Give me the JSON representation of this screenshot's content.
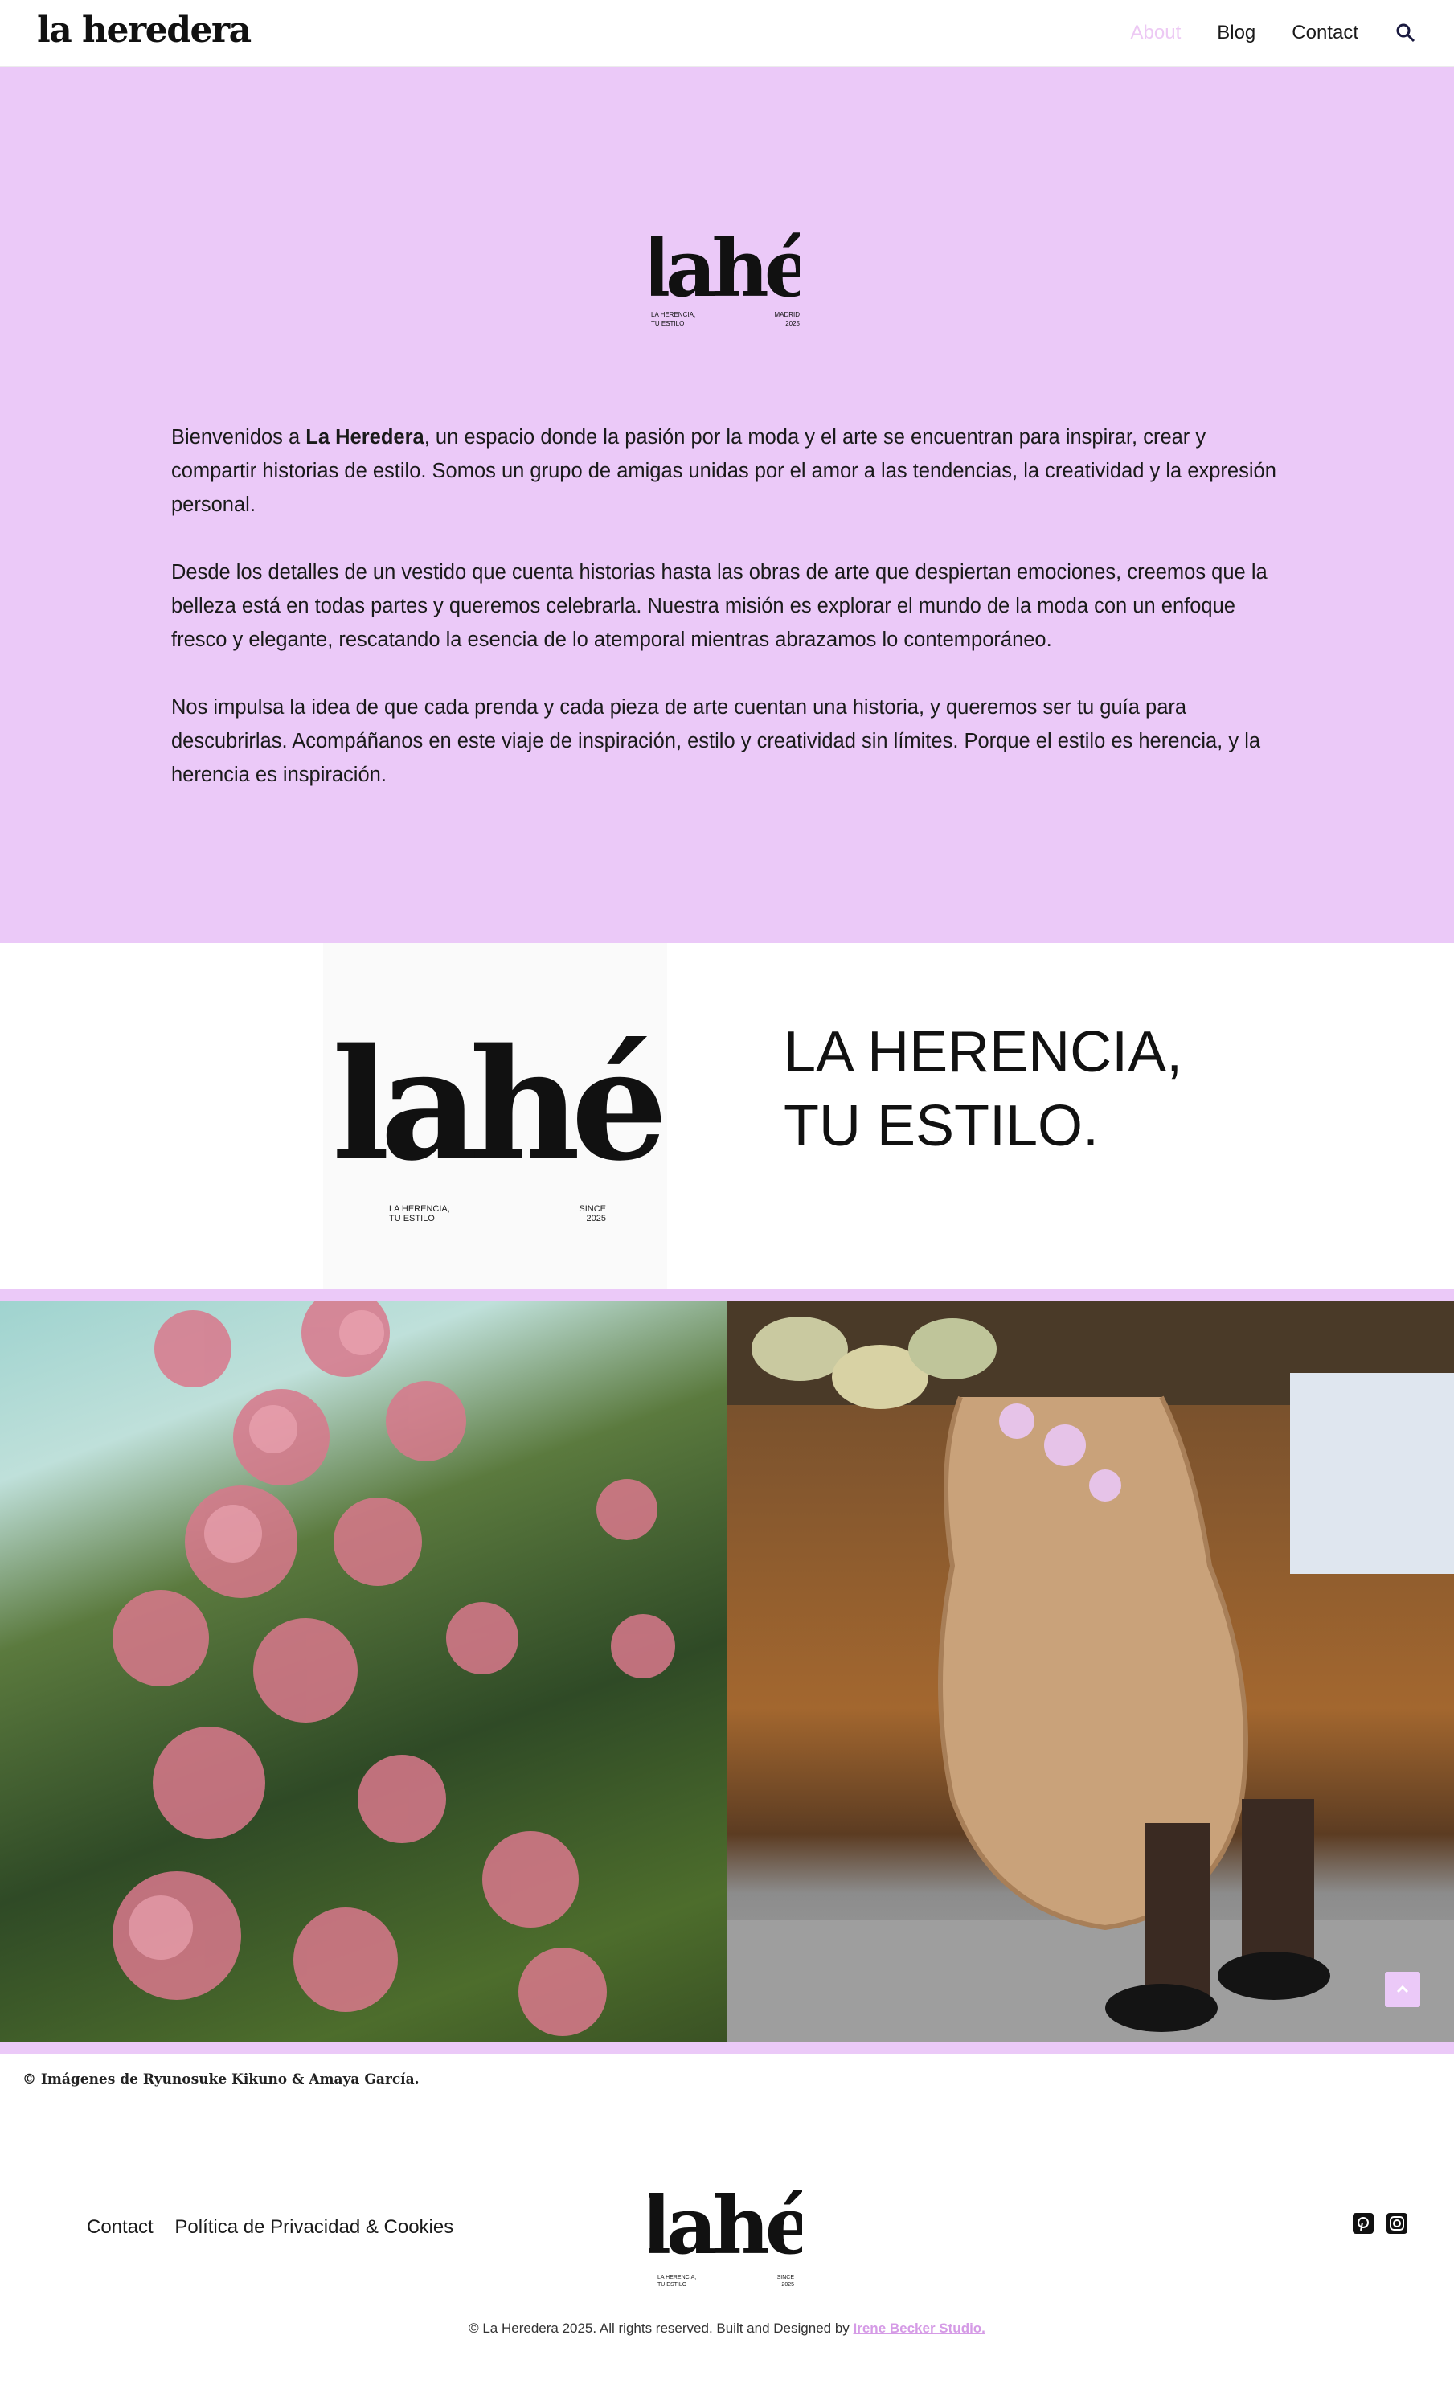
{
  "header": {
    "brand": "la heredera",
    "nav": [
      {
        "label": "About",
        "active": true
      },
      {
        "label": "Blog",
        "active": false
      },
      {
        "label": "Contact",
        "active": false
      }
    ],
    "search_icon": "search-icon"
  },
  "about": {
    "logo": {
      "word": "lahé",
      "small_left": "LA HERENCIA,\nTU ESTILO",
      "small_right": "MADRID\n2025"
    },
    "p1_a": "Bienvenidos a ",
    "p1_b": "La Heredera",
    "p1_c": ", un espacio donde la pasión por la moda y el arte se encuentran para inspirar, crear y compartir historias de estilo. Somos un grupo de amigas unidas por el amor a las tendencias, la creatividad y la expresión personal.",
    "p2": "Desde los detalles de un vestido que cuenta historias hasta las obras de arte que despiertan emociones, creemos que la belleza está en todas partes y queremos celebrarla. Nuestra misión es explorar el mundo de la moda con un enfoque fresco y elegante, rescatando la esencia de lo atemporal mientras abrazamos lo contemporáneo.",
    "p3": "Nos impulsa la idea de que cada prenda y cada pieza de arte cuentan una historia, y queremos ser tu guía para descubrirlas. Acompáñanos en este viaje de inspiración, estilo y creatividad sin límites. Porque el estilo es herencia, y la herencia es inspiración."
  },
  "herencia": {
    "logo": {
      "word": "lahé",
      "small_left": "LA HERENCIA,\nTU ESTILO",
      "small_right": "SINCE\n2025"
    },
    "line1": "LA HERENCIA,",
    "line2": "TU ESTILO."
  },
  "credit": "© Imágenes de Ryunosuke Kikuno & Amaya García.",
  "footer": {
    "links": [
      "Contact",
      "Política de Privacidad & Cookies"
    ],
    "logo": {
      "word": "lahé",
      "small_left": "LA HERENCIA,\nTU ESTILO",
      "small_right": "SINCE\n2025"
    },
    "social": [
      "pinterest-icon",
      "instagram-icon"
    ],
    "copyright_prefix": "© La Heredera 2025. All rights reserved. Built and Designed by ",
    "studio": "Irene Becker Studio."
  },
  "colors": {
    "accent": "#ebc9f8",
    "active_nav": "#edc9f4",
    "studio_link": "#d59be6"
  }
}
